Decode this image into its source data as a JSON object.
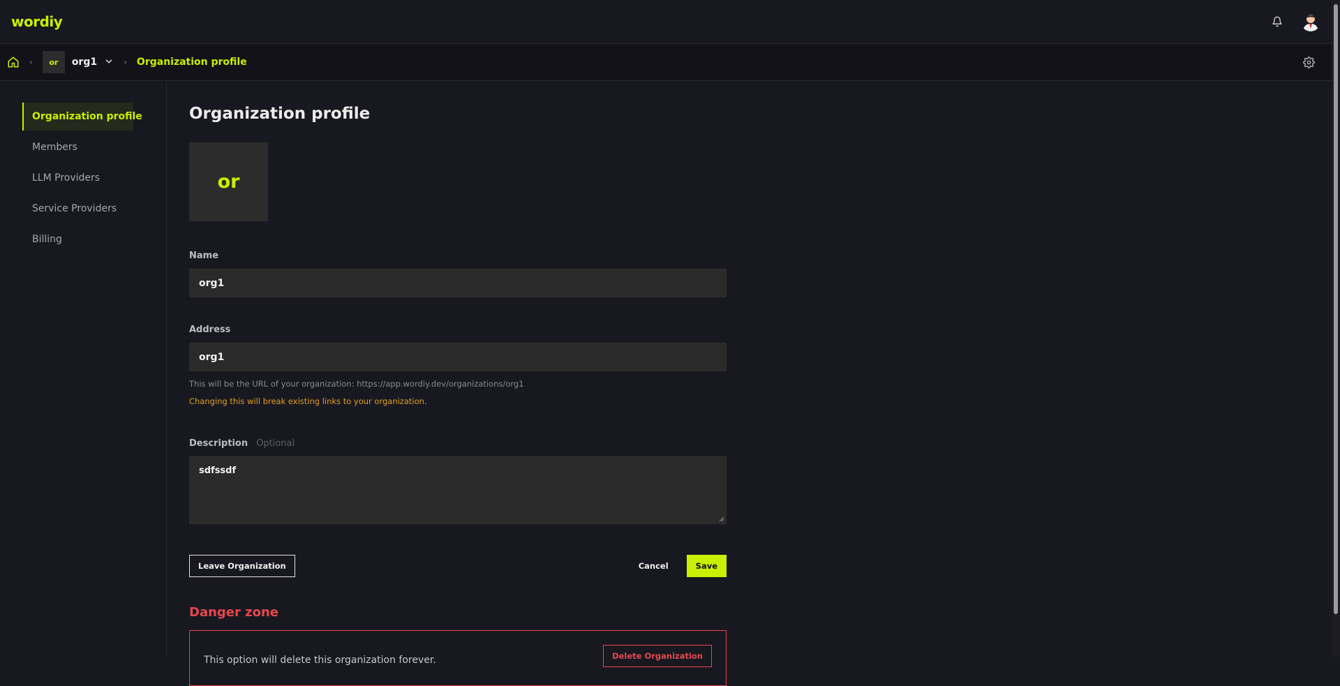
{
  "colors": {
    "accent": "#c8f000",
    "danger": "#e5484d",
    "warning": "#e0a020"
  },
  "header": {
    "logo": "wordiy",
    "icons": [
      "bell-icon",
      "user-avatar"
    ]
  },
  "breadcrumb": {
    "home_icon": "home-icon",
    "org_badge": "or",
    "org_name": "org1",
    "current": "Organization profile",
    "settings_icon": "gear-icon"
  },
  "sidebar": {
    "items": [
      {
        "label": "Organization profile",
        "active": true
      },
      {
        "label": "Members"
      },
      {
        "label": "LLM Providers"
      },
      {
        "label": "Service Providers"
      },
      {
        "label": "Billing"
      }
    ]
  },
  "main": {
    "title": "Organization profile",
    "avatar_text": "or",
    "name": {
      "label": "Name",
      "value": "org1"
    },
    "address": {
      "label": "Address",
      "value": "org1",
      "hint": "This will be the URL of your organization: https://app.wordiy.dev/organizations/org1",
      "warning": "Changing this will break existing links to your organization."
    },
    "description": {
      "label": "Description",
      "optional": "Optional",
      "value": "sdfssdf"
    },
    "actions": {
      "leave": "Leave Organization",
      "cancel": "Cancel",
      "save": "Save"
    },
    "danger": {
      "title": "Danger zone",
      "text": "This option will delete this organization forever.",
      "button": "Delete Organization"
    }
  }
}
